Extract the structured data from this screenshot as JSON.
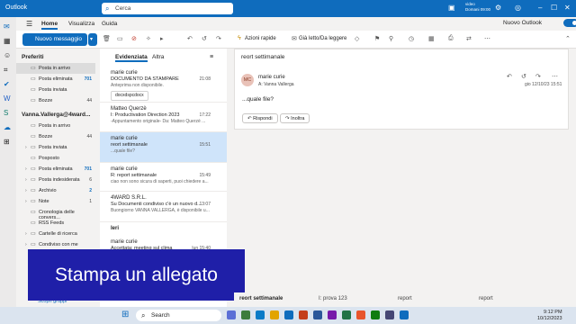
{
  "titlebar": {
    "app": "Outlook",
    "search_placeholder": "Cerca",
    "video_label": "video",
    "meeting": "Domani 09:00"
  },
  "ribbon_tabs": {
    "home": "Home",
    "view": "Visualizza",
    "help": "Guida",
    "new_outlook": "Nuovo Outlook"
  },
  "ribbon": {
    "new_mail": "Nuovo messaggio",
    "quick_actions": "Azioni rapide",
    "read_unread": "Già letto/Da leggere"
  },
  "folders": {
    "favorites": "Preferiti",
    "fav_items": [
      {
        "label": "Posta in arrivo",
        "count": ""
      },
      {
        "label": "Posta eliminata",
        "count": "701"
      },
      {
        "label": "Posta inviata",
        "count": ""
      },
      {
        "label": "Bozze",
        "count": "44"
      }
    ],
    "account": "Vanna.Vallerga@4ward...",
    "acc_items": [
      {
        "label": "Posta in arrivo",
        "count": ""
      },
      {
        "label": "Bozze",
        "count": "44"
      },
      {
        "label": "Posta inviata",
        "count": ""
      },
      {
        "label": "Posposto",
        "count": ""
      },
      {
        "label": "Posta eliminata",
        "count": "701"
      },
      {
        "label": "Posta indesiderata",
        "count": "6"
      },
      {
        "label": "Archivio",
        "count": "2"
      },
      {
        "label": "Note",
        "count": "1"
      },
      {
        "label": "Cronologia delle convers...",
        "count": ""
      },
      {
        "label": "RSS Feeds",
        "count": ""
      },
      {
        "label": "Cartelle di ricerca",
        "count": ""
      },
      {
        "label": "Condiviso con me",
        "count": ""
      }
    ],
    "groups": "Scopri gruppi"
  },
  "list": {
    "tab_focused": "Evidenziata",
    "tab_other": "Altra",
    "messages": [
      {
        "from": "marie curie",
        "time": "21:08",
        "subject": "DOCUMENTO DA STAMPARE",
        "preview": "Anteprima non disponibile.",
        "attachment": "docxdspcdocx"
      },
      {
        "from": "Matteo Querzè",
        "time": "17:22",
        "subject": "I: Productivation Direction 2023",
        "preview": "-Appuntamento originale- Da: Matteo Querzè ..."
      },
      {
        "from": "marie curie",
        "time": "15:51",
        "subject": "reort settimanale",
        "preview": "...quale file?"
      },
      {
        "from": "marie curie",
        "time": "15:49",
        "subject": "R: report settimanale",
        "preview": "ciao non sono sicura di saperti, puoi chiedere a..."
      },
      {
        "from": "4WARD S.R.L.",
        "time": "13:07",
        "subject": "Su Documenti condiviso c'è un nuovo d...",
        "preview": "Buongiorno VANNA VALLERGA, è disponibile u..."
      }
    ],
    "yesterday": "Ieri",
    "y_message": {
      "from": "marie curie",
      "time": "lun 15:40",
      "subject": "Accettata: meeting sul clima",
      "preview": "ci sarò e discuteremo anche del report"
    }
  },
  "reading": {
    "subject": "reort settimanale",
    "initials": "MC",
    "from": "marie curie",
    "to": "A: Vanna Vallerga",
    "date": "gio 12/10/23 15:51",
    "body": "...quale file?",
    "reply": "Rispondi",
    "forward": "Inoltra"
  },
  "banner": "Stampa un allegato",
  "drafts": [
    "reort settimanale",
    "I: prova 123",
    "report",
    "report"
  ],
  "taskbar": {
    "search": "Search",
    "time": "9:12 PM",
    "date": "10/12/2023"
  }
}
